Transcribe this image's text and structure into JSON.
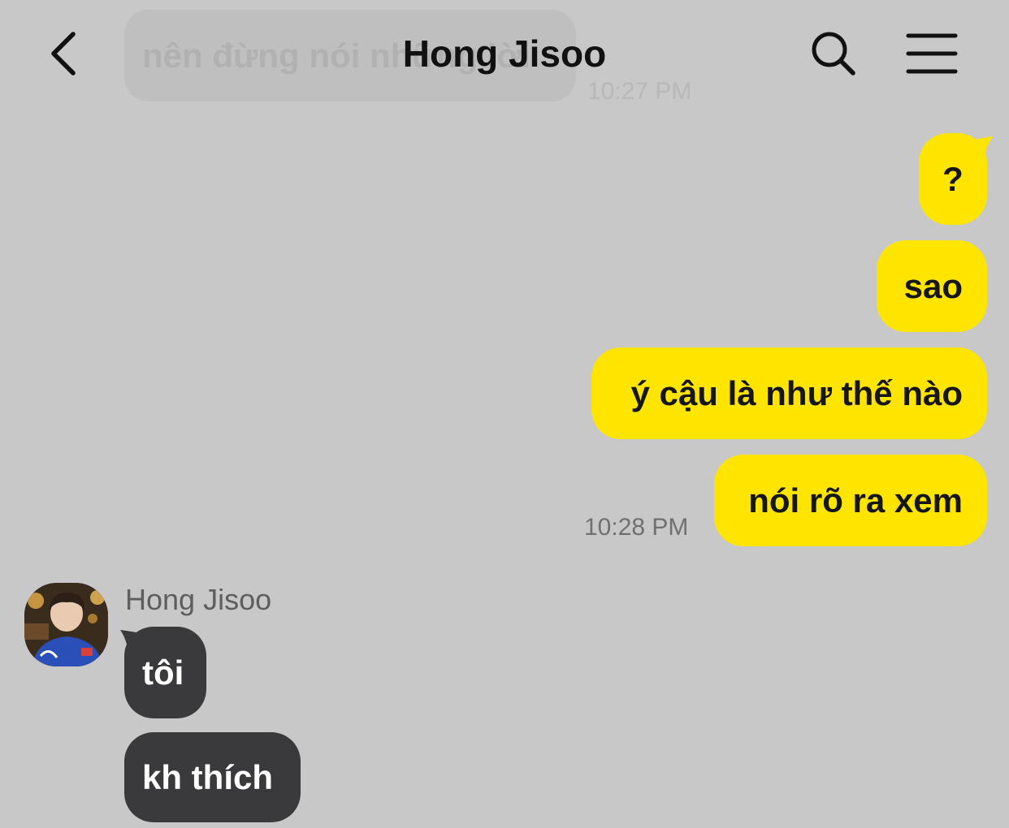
{
  "header": {
    "title": "Hong Jisoo"
  },
  "previous_message": {
    "text": "nên đừng nói những lời",
    "time": "10:27 PM"
  },
  "my_messages": [
    {
      "text": "?"
    },
    {
      "text": "sao"
    },
    {
      "text": "ý cậu là như thế nào"
    },
    {
      "text": "nói rõ ra xem",
      "time": "10:28 PM"
    }
  ],
  "their_group": {
    "sender": "Hong Jisoo",
    "messages": [
      {
        "text": "tôi"
      },
      {
        "text": "kh thích"
      }
    ]
  },
  "colors": {
    "background": "#c8c8c8",
    "my_bubble": "#fee500",
    "their_bubble": "#3a3a3c"
  },
  "icons": [
    "chevron-left-icon",
    "search-icon",
    "hamburger-menu-icon"
  ]
}
